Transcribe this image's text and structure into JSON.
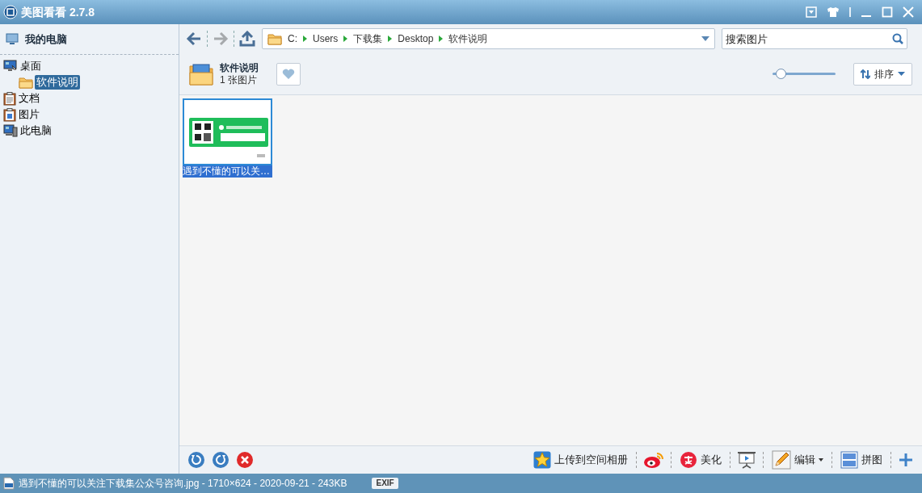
{
  "window": {
    "title": "美图看看 2.7.8"
  },
  "sidebar": {
    "header": "我的电脑",
    "tree": [
      {
        "label": "桌面",
        "kind": "desktop",
        "selected": false,
        "children": [
          {
            "label": "软件说明",
            "kind": "folder",
            "selected": true
          }
        ]
      },
      {
        "label": "文档",
        "kind": "documents",
        "selected": false
      },
      {
        "label": "图片",
        "kind": "pictures",
        "selected": false
      },
      {
        "label": "此电脑",
        "kind": "computer",
        "selected": false
      }
    ]
  },
  "nav": {
    "path": [
      "C:",
      "Users",
      "下载集",
      "Desktop",
      "软件说明"
    ],
    "search": {
      "placeholder": "搜索图片"
    }
  },
  "folder": {
    "name": "软件说明",
    "count": "1 张图片",
    "zoom": {
      "level": 0.05
    },
    "sort": "排序"
  },
  "thumbnails": [
    {
      "kind": "picture",
      "caption": "遇到不懂的可以关…",
      "selected": true
    }
  ],
  "tools": [
    {
      "kind": "upload",
      "label": "上传到空间相册"
    },
    {
      "kind": "weibo"
    },
    {
      "kind": "beautify",
      "label": "美化"
    },
    {
      "kind": "slideshow"
    },
    {
      "kind": "edit",
      "label": "编辑"
    },
    {
      "kind": "collage",
      "label": "拼图"
    },
    {
      "kind": "add"
    }
  ],
  "status_bar": {
    "file": "遇到不懂的可以关注下载集公众号咨询.jpg - 1710×624 - 2020-09-21 - 243KB",
    "exif": "EXIF"
  }
}
